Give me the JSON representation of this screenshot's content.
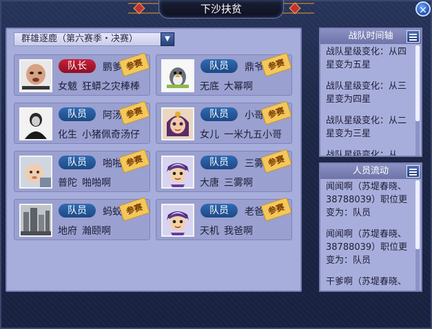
{
  "window": {
    "title": "下沙扶贫",
    "close_label": "×"
  },
  "dropdown": {
    "selected": "群雄逐鹿（第六赛季・决赛）"
  },
  "stamp_label": "参赛",
  "members": [
    {
      "role": "队长",
      "name": "鹏爹",
      "school": "女魃",
      "nick": "狂蟒之灾棒棒",
      "avatar": "meme-baby-photo-avatar"
    },
    {
      "role": "队员",
      "name": "鼎爷",
      "school": "无底",
      "nick": "大幂啊",
      "avatar": "penguin-cartoon-avatar"
    },
    {
      "role": "队员",
      "name": "阿汤",
      "school": "化生",
      "nick": "小猪佩奇汤仔",
      "avatar": "bw-portrait-avatar"
    },
    {
      "role": "队员",
      "name": "小哥",
      "school": "女儿",
      "nick": "一米九五小哥",
      "avatar": "game-character-girl-avatar"
    },
    {
      "role": "队员",
      "name": "啪啪",
      "school": "普陀",
      "nick": "啪啪啊",
      "avatar": "baby-photo-avatar"
    },
    {
      "role": "队员",
      "name": "三雾",
      "school": "大唐",
      "nick": "三雾啊",
      "avatar": "game-character-boy-avatar"
    },
    {
      "role": "队员",
      "name": "蚂蚁",
      "school": "地府",
      "nick": "瀚颐啊",
      "avatar": "rain-city-avatar"
    },
    {
      "role": "队员",
      "name": "老爸",
      "school": "天机",
      "nick": "我爸啊",
      "avatar": "game-character-boy-avatar"
    }
  ],
  "timeline": {
    "title": "战队时间轴",
    "entries": [
      "战队星级变化：从四星变为五星",
      "战队星级变化：从三星变为四星",
      "战队星级变化：从二星变为三星",
      "战队星级变化：从"
    ]
  },
  "flow": {
    "title": "人员流动",
    "entries": [
      "闻闻啊（苏堤春晓、38788039）职位更变为：队员",
      "闻闻啊（苏堤春晓、38788039）职位更变为：队员",
      "干爹啊（苏堤春晓、"
    ]
  },
  "colors": {
    "leader_badge": "#c8213a",
    "member_badge": "#2f6bb4",
    "panel_bg": "#a8aedb",
    "stamp": "#f3c85a"
  }
}
